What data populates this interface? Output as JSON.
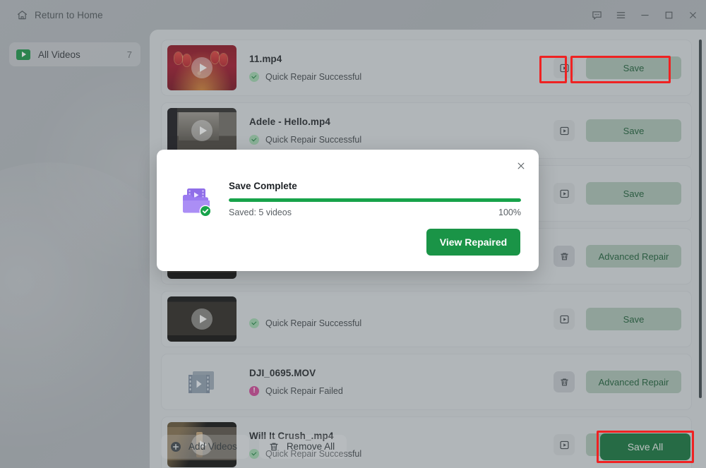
{
  "titlebar": {
    "home_label": "Return to Home",
    "icons": {
      "home": "home-icon",
      "feedback": "feedback-icon",
      "menu": "hamburger-menu-icon",
      "minimize": "minimize-icon",
      "maximize": "maximize-icon",
      "close": "close-icon"
    }
  },
  "sidebar": {
    "items": [
      {
        "label": "All Videos",
        "count": "7",
        "icon": "video-play-icon"
      }
    ]
  },
  "list": {
    "rows": [
      {
        "name": "11.mp4",
        "status": "Quick Repair Successful",
        "status_type": "ok",
        "thumb": "red-lantern-thumbnail",
        "action": "Save",
        "left_icon": "play-icon"
      },
      {
        "name": "Adele - Hello.mp4",
        "status": "Quick Repair Successful",
        "status_type": "ok",
        "thumb": "room-thumbnail",
        "action": "Save",
        "left_icon": "play-icon"
      },
      {
        "name": "",
        "status": "",
        "status_type": "ok",
        "thumb": "dark-thumbnail",
        "action": "Save",
        "left_icon": "play-icon"
      },
      {
        "name": "",
        "status": "",
        "status_type": "fail",
        "thumb": "dark-thumbnail",
        "action": "Advanced Repair",
        "left_icon": "trash-icon"
      },
      {
        "name": "",
        "status": "Quick Repair Successful",
        "status_type": "ok",
        "thumb": "dark-thumbnail",
        "action": "Save",
        "left_icon": "play-icon"
      },
      {
        "name": "DJI_0695.MOV",
        "status": "Quick Repair Failed",
        "status_type": "fail",
        "thumb": "film-strip-icon",
        "action": "Advanced Repair",
        "left_icon": "trash-icon"
      },
      {
        "name": "Will It Crush_.mp4",
        "status": "Quick Repair Successful",
        "status_type": "ok",
        "thumb": "crush-thumbnail",
        "action": "Save",
        "left_icon": "play-icon"
      }
    ]
  },
  "bottombar": {
    "add_videos": "Add Videos",
    "remove_all": "Remove All",
    "save_all": "Save All"
  },
  "modal": {
    "title": "Save Complete",
    "saved_text": "Saved: 5 videos",
    "percent": "100%",
    "progress_value": 100,
    "button": "View Repaired",
    "icon": "folder-video-complete-icon",
    "close_icon": "close-icon"
  },
  "colors": {
    "accent_green": "#1a9447",
    "primary_green": "#12713a",
    "progress_green": "#17a34a",
    "fail_pink": "#cf4596",
    "annotation_red": "#ef2222",
    "panel_bg": "#d6dadd"
  }
}
